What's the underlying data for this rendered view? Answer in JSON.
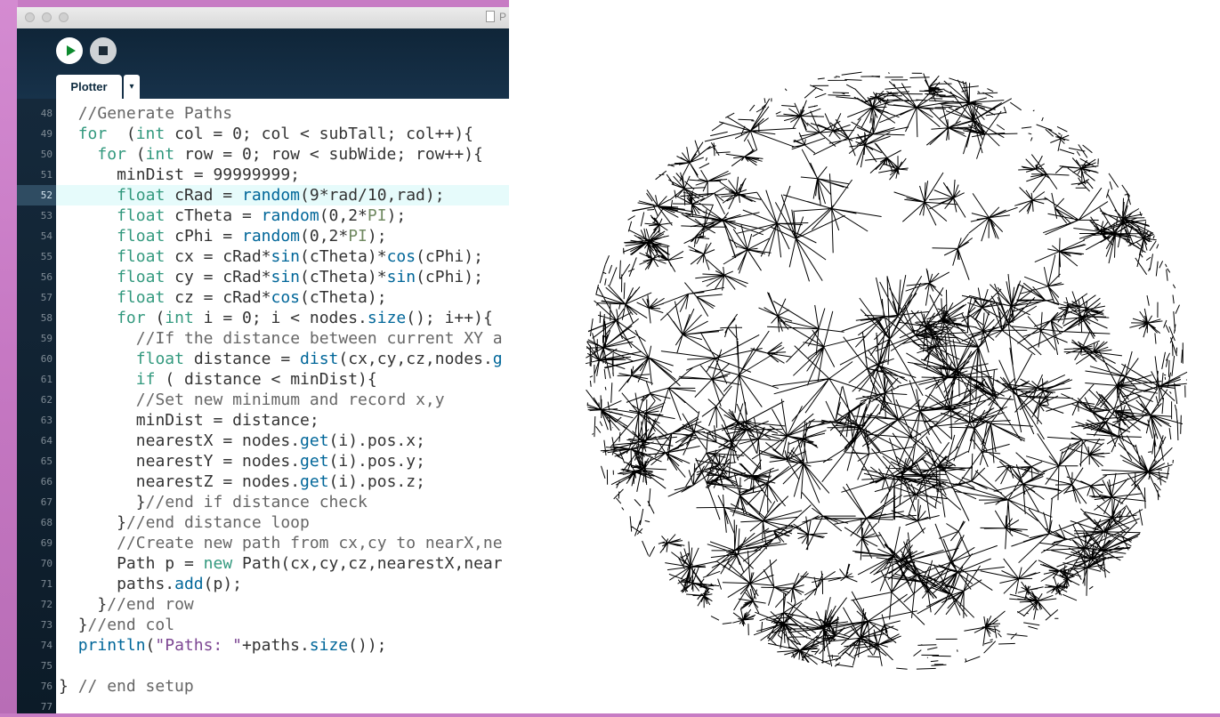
{
  "window": {
    "title": "P"
  },
  "toolbar": {
    "run_icon": "play-icon",
    "stop_icon": "stop-icon"
  },
  "tabs": [
    {
      "label": "Plotter"
    }
  ],
  "tab_menu": {
    "glyph": "▾"
  },
  "editor": {
    "current_line": 52,
    "colors": {
      "keyword": "#33997e",
      "function": "#006699",
      "comment": "#666666",
      "string": "#7d4793",
      "constant": "#718a62"
    },
    "lines": [
      {
        "n": "48",
        "indent": 2,
        "segs": [
          [
            "c",
            "//Generate Paths"
          ]
        ]
      },
      {
        "n": "49",
        "indent": 2,
        "segs": [
          [
            "k",
            "for"
          ],
          [
            "",
            "  ("
          ],
          [
            "k",
            "int"
          ],
          [
            "",
            " col = 0; col < subTall; col++){"
          ]
        ]
      },
      {
        "n": "50",
        "indent": 4,
        "segs": [
          [
            "k",
            "for"
          ],
          [
            "",
            " ("
          ],
          [
            "k",
            "int"
          ],
          [
            "",
            " row = 0; row < subWide; row++){"
          ]
        ]
      },
      {
        "n": "51",
        "indent": 6,
        "segs": [
          [
            "",
            "minDist = 99999999;"
          ]
        ]
      },
      {
        "n": "52",
        "indent": 6,
        "segs": [
          [
            "k",
            "float"
          ],
          [
            "",
            " cRad = "
          ],
          [
            "f",
            "random"
          ],
          [
            "",
            "(9*rad/10,rad);"
          ]
        ]
      },
      {
        "n": "53",
        "indent": 6,
        "segs": [
          [
            "k",
            "float"
          ],
          [
            "",
            " cTheta = "
          ],
          [
            "f",
            "random"
          ],
          [
            "",
            "(0,2*"
          ],
          [
            "ct",
            "PI"
          ],
          [
            "",
            ");"
          ]
        ]
      },
      {
        "n": "54",
        "indent": 6,
        "segs": [
          [
            "k",
            "float"
          ],
          [
            "",
            " cPhi = "
          ],
          [
            "f",
            "random"
          ],
          [
            "",
            "(0,2*"
          ],
          [
            "ct",
            "PI"
          ],
          [
            "",
            ");"
          ]
        ]
      },
      {
        "n": "55",
        "indent": 6,
        "segs": [
          [
            "k",
            "float"
          ],
          [
            "",
            " cx = cRad*"
          ],
          [
            "f",
            "sin"
          ],
          [
            "",
            "(cTheta)*"
          ],
          [
            "f",
            "cos"
          ],
          [
            "",
            "(cPhi);"
          ]
        ]
      },
      {
        "n": "56",
        "indent": 6,
        "segs": [
          [
            "k",
            "float"
          ],
          [
            "",
            " cy = cRad*"
          ],
          [
            "f",
            "sin"
          ],
          [
            "",
            "(cTheta)*"
          ],
          [
            "f",
            "sin"
          ],
          [
            "",
            "(cPhi);"
          ]
        ]
      },
      {
        "n": "57",
        "indent": 6,
        "segs": [
          [
            "k",
            "float"
          ],
          [
            "",
            " cz = cRad*"
          ],
          [
            "f",
            "cos"
          ],
          [
            "",
            "(cTheta);"
          ]
        ]
      },
      {
        "n": "58",
        "indent": 6,
        "segs": [
          [
            "k",
            "for"
          ],
          [
            "",
            " ("
          ],
          [
            "k",
            "int"
          ],
          [
            "",
            " i = 0; i < nodes."
          ],
          [
            "f",
            "size"
          ],
          [
            "",
            "(); i++){"
          ]
        ]
      },
      {
        "n": "59",
        "indent": 8,
        "segs": [
          [
            "c",
            "//If the distance between current XY a"
          ]
        ]
      },
      {
        "n": "60",
        "indent": 8,
        "segs": [
          [
            "k",
            "float"
          ],
          [
            "",
            " distance = "
          ],
          [
            "f",
            "dist"
          ],
          [
            "",
            "(cx,cy,cz,nodes."
          ],
          [
            "f",
            "g"
          ]
        ]
      },
      {
        "n": "61",
        "indent": 8,
        "segs": [
          [
            "k",
            "if"
          ],
          [
            "",
            " ( distance < minDist){"
          ]
        ]
      },
      {
        "n": "62",
        "indent": 8,
        "segs": [
          [
            "c",
            "//Set new minimum and record x,y"
          ]
        ]
      },
      {
        "n": "63",
        "indent": 8,
        "segs": [
          [
            "",
            "minDist = distance;"
          ]
        ]
      },
      {
        "n": "64",
        "indent": 8,
        "segs": [
          [
            "",
            "nearestX = nodes."
          ],
          [
            "f",
            "get"
          ],
          [
            "",
            "(i).pos.x;"
          ]
        ]
      },
      {
        "n": "65",
        "indent": 8,
        "segs": [
          [
            "",
            "nearestY = nodes."
          ],
          [
            "f",
            "get"
          ],
          [
            "",
            "(i).pos.y;"
          ]
        ]
      },
      {
        "n": "66",
        "indent": 8,
        "segs": [
          [
            "",
            "nearestZ = nodes."
          ],
          [
            "f",
            "get"
          ],
          [
            "",
            "(i).pos.z;"
          ]
        ]
      },
      {
        "n": "67",
        "indent": 8,
        "segs": [
          [
            "",
            "}"
          ],
          [
            "c",
            "//end if distance check"
          ]
        ]
      },
      {
        "n": "68",
        "indent": 6,
        "segs": [
          [
            "",
            "}"
          ],
          [
            "c",
            "//end distance loop"
          ]
        ]
      },
      {
        "n": "69",
        "indent": 6,
        "segs": [
          [
            "c",
            "//Create new path from cx,cy to nearX,ne"
          ]
        ]
      },
      {
        "n": "70",
        "indent": 6,
        "segs": [
          [
            "",
            "Path p = "
          ],
          [
            "k",
            "new"
          ],
          [
            "",
            " Path(cx,cy,cz,nearestX,near"
          ]
        ]
      },
      {
        "n": "71",
        "indent": 6,
        "segs": [
          [
            "",
            "paths."
          ],
          [
            "f",
            "add"
          ],
          [
            "",
            "(p);"
          ]
        ]
      },
      {
        "n": "72",
        "indent": 4,
        "segs": [
          [
            "",
            "}"
          ],
          [
            "c",
            "//end row"
          ]
        ]
      },
      {
        "n": "73",
        "indent": 2,
        "segs": [
          [
            "",
            "}"
          ],
          [
            "c",
            "//end col"
          ]
        ]
      },
      {
        "n": "74",
        "indent": 2,
        "segs": [
          [
            "f",
            "println"
          ],
          [
            "",
            "("
          ],
          [
            "s",
            "\"Paths: \""
          ],
          [
            "",
            "+paths."
          ],
          [
            "f",
            "size"
          ],
          [
            "",
            "());"
          ]
        ]
      },
      {
        "n": "75",
        "indent": 0,
        "segs": []
      },
      {
        "n": "76",
        "indent": 0,
        "segs": [
          [
            "",
            "} "
          ],
          [
            "c",
            "// end setup"
          ]
        ]
      },
      {
        "n": "77",
        "indent": 0,
        "segs": []
      }
    ]
  },
  "sketch": {
    "description_icon": "plotted-sphere",
    "line_color": "#000000"
  }
}
